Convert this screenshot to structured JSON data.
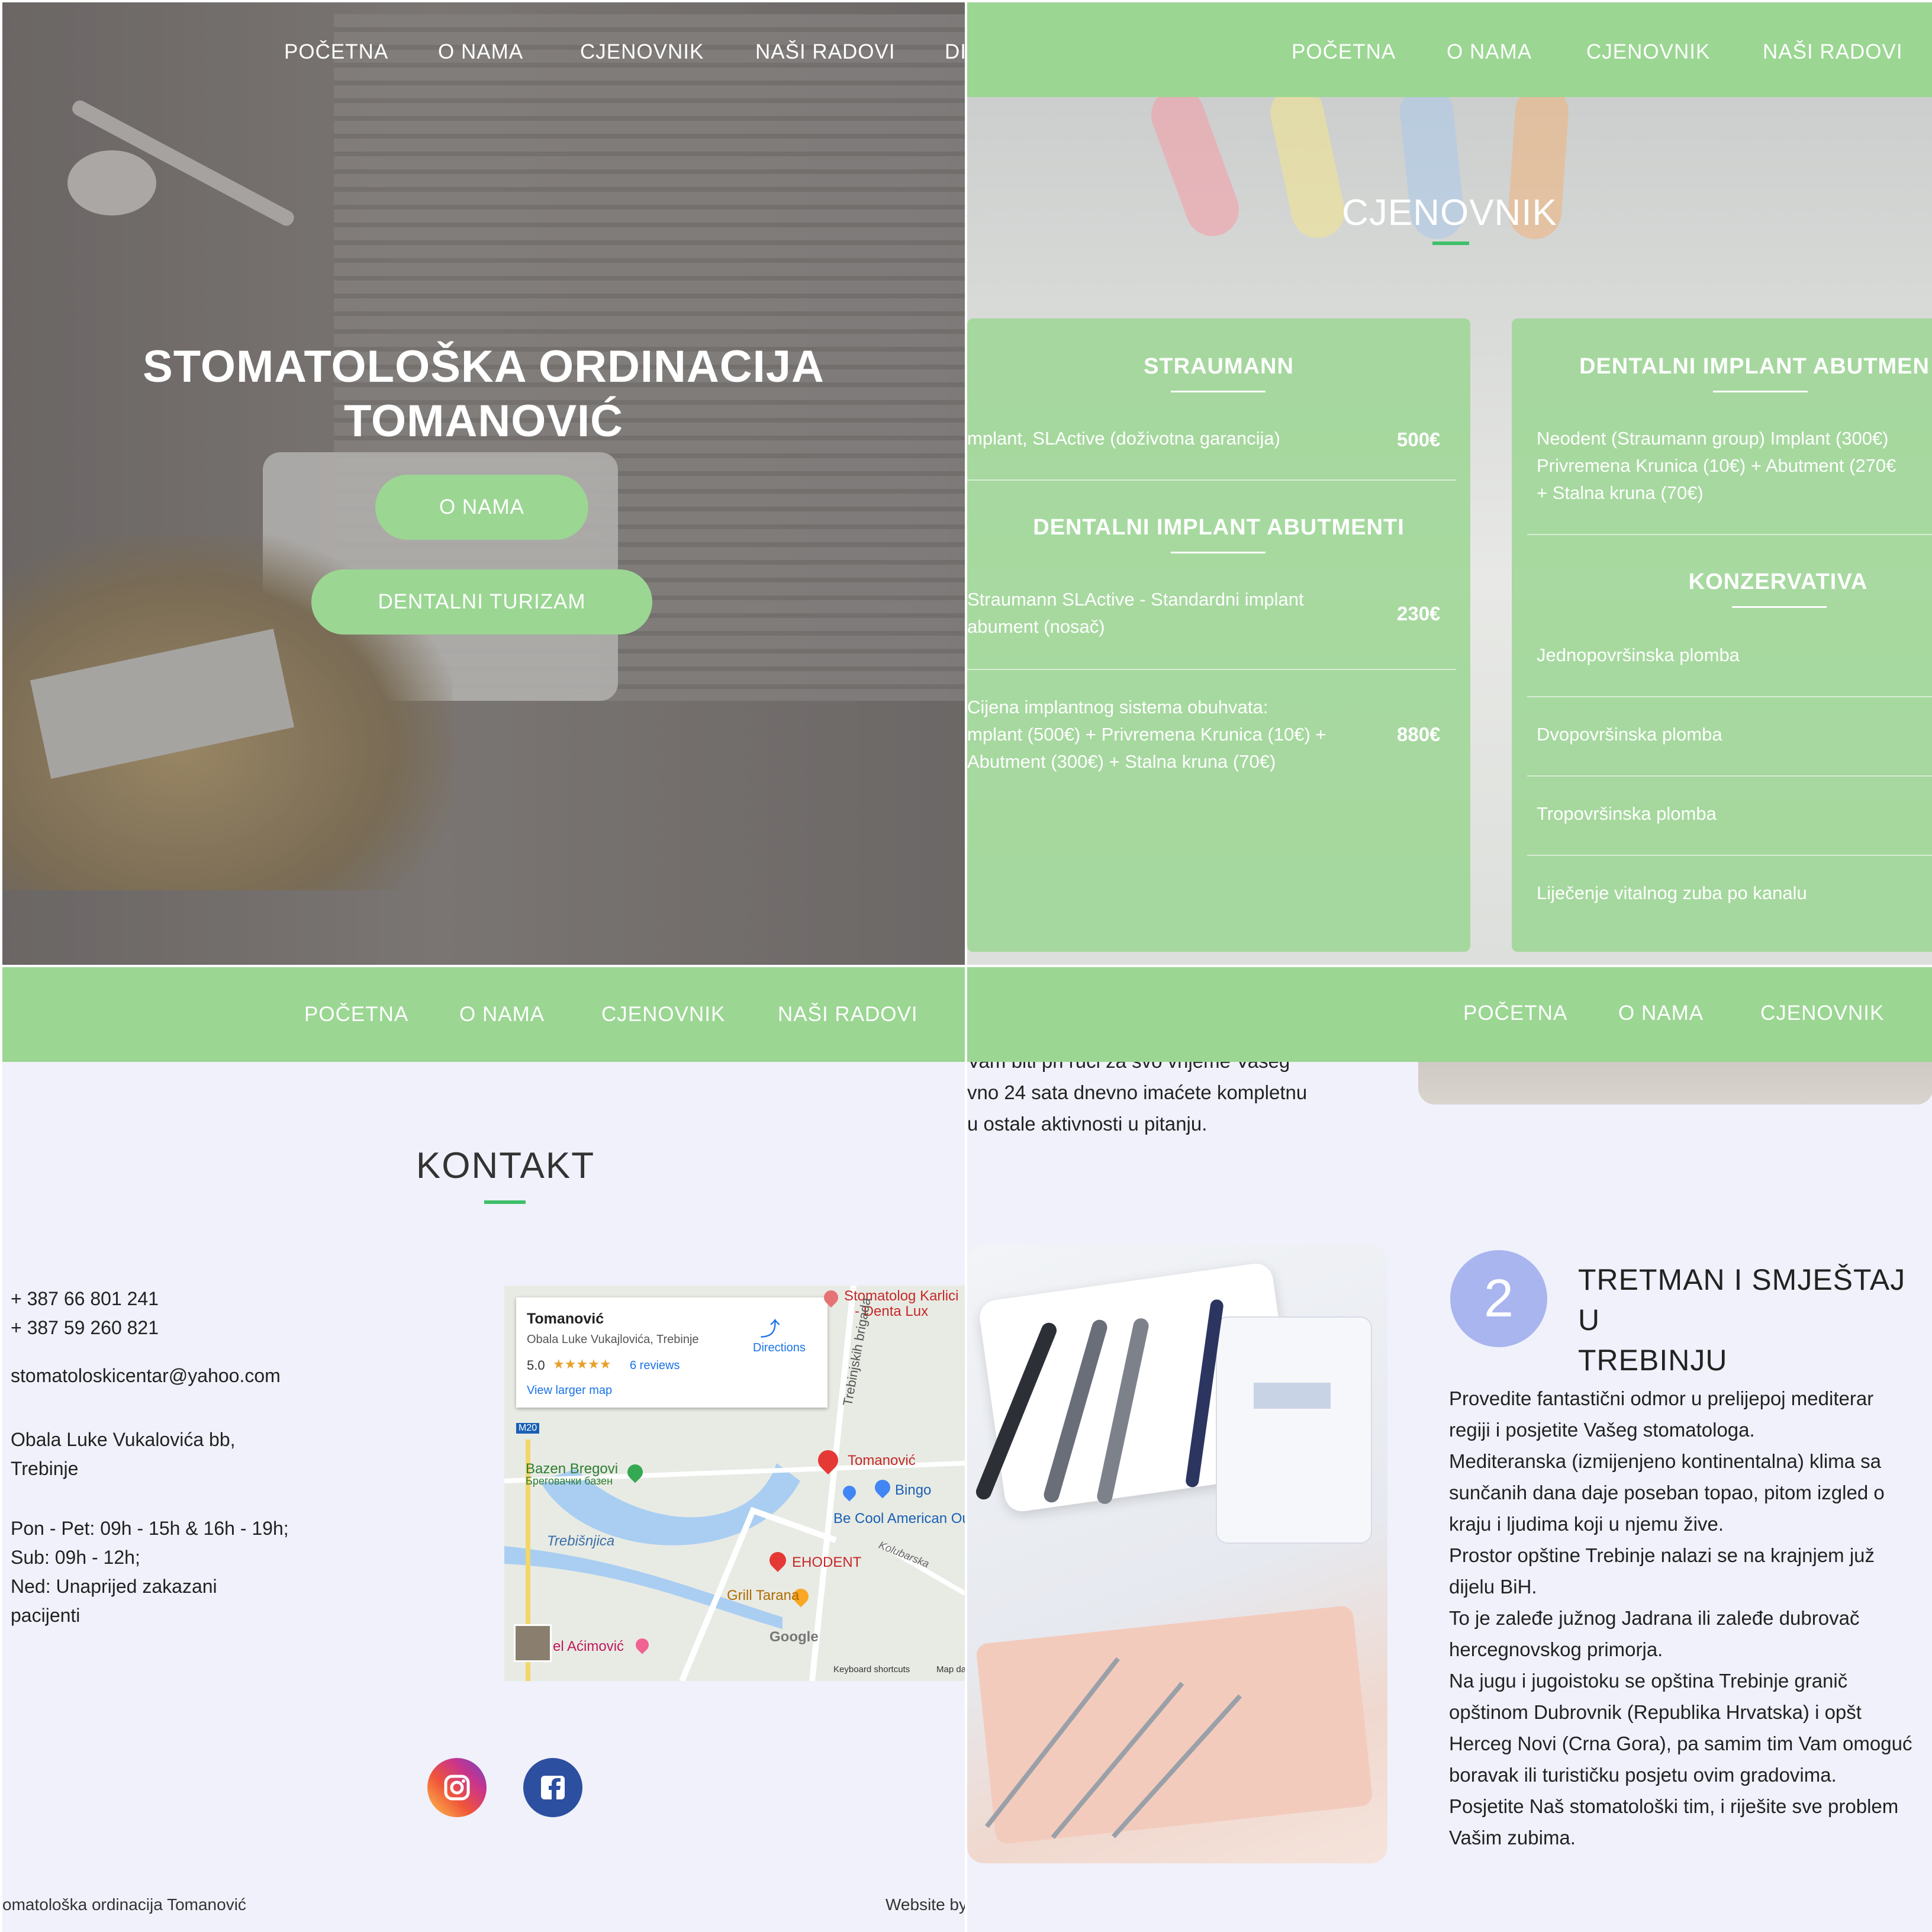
{
  "nav": {
    "items": [
      "POČETNA",
      "O NAMA",
      "CJENOVNIK",
      "NAŠI RADOVI",
      "DI"
    ]
  },
  "hero": {
    "title_line1": "STOMATOLOŠKA ORDINACIJA",
    "title_line2": "TOMANOVIĆ",
    "btn_about": "O NAMA",
    "btn_tourism": "DENTALNI TURIZAM"
  },
  "pricing": {
    "title": "CJENOVNIK",
    "left_card": {
      "section1_title": "STRAUMANN",
      "row1_text": "mplant, SLActive (doživotna garancija)",
      "row1_price": "500€",
      "section2_title": "DENTALNI IMPLANT ABUTMENTI",
      "row2_line1": "Straumann SLActive - Standardni implant",
      "row2_line2": "abument (nosač)",
      "row2_price": "230€",
      "row3_line1": "Cijena implantnog sistema obuhvata:",
      "row3_line2": "mplant (500€) + Privremena Krunica (10€) +",
      "row3_line3": "Abutment (300€) + Stalna kruna (70€)",
      "row3_price": "880€"
    },
    "right_card": {
      "section1_title": "DENTALNI IMPLANT ABUTMEN",
      "row1_line1": "Neodent (Straumann group) Implant (300€)",
      "row1_line2": "Privremena Krunica (10€) + Abutment (270€",
      "row1_line3": "+ Stalna kruna (70€)",
      "section2_title": "KONZERVATIVA",
      "items": [
        "Jednopovršinska plomba",
        "Dvopovršinska plomba",
        "Tropovršinska plomba",
        "Liječenje vitalnog zuba po kanalu"
      ]
    }
  },
  "contact": {
    "title": "KONTAKT",
    "phone1": "+ 387 66 801 241",
    "phone2": "+ 387 59 260 821",
    "email": "stomatoloskicentar@yahoo.com",
    "address_line1": "Obala Luke Vukalovića bb,",
    "address_line2": "Trebinje",
    "hours_line1": "Pon - Pet: 09h - 15h & 16h - 19h;",
    "hours_line2": "Sub: 09h - 12h;",
    "hours_line3": "Ned: Unaprijed zakazani",
    "hours_line4": "pacijenti",
    "map": {
      "place_name": "Tomanović",
      "place_address": "Obala Luke Vukajlovića, Trebinje",
      "rating": "5.0",
      "stars": "★★★★★",
      "reviews": "6 reviews",
      "larger_map": "View larger map",
      "directions": "Directions",
      "labels": {
        "stomatolog1": "Stomatolog Karlici",
        "stomatolog2": "- Denta Lux",
        "brigada": "Trebinjskih brigada",
        "m20": "M20",
        "bazen1": "Bazen Bregovi",
        "bazen2": "Бреговачки базен",
        "tomanovic": "Tomanović",
        "bingo": "Bingo",
        "becool": "Be Cool American Ou",
        "trebisnjica": "Trebišnjica",
        "kolubarska": "Kolubarska",
        "ehodent": "EHODENT",
        "grill": "Grill Tarana",
        "acimovic": "el Aćimović",
        "google": "Google",
        "keyboard": "Keyboard shortcuts",
        "mapdata": "Map da"
      }
    },
    "footer_left": "omatološka ordinacija Tomanović",
    "footer_right": "Website by"
  },
  "tourism": {
    "intro_line1": "Vam biti pri ruci za svo vrijeme Vašeg",
    "intro_line2": "vno 24 sata dnevno imaćete kompletnu",
    "intro_line3": "u ostale aktivnosti u pitanju.",
    "step_number": "2",
    "step_title_line1": "TRETMAN I SMJEŠTAJ U",
    "step_title_line2": "TREBINJU",
    "p_lines": [
      "Provedite fantastični odmor u prelijepoj mediterar",
      "regiji i posjetite Vašeg stomatologa.",
      "Mediteranska (izmijenjeno kontinentalna) klima sa",
      "sunčanih dana daje poseban topao, pitom izgled o",
      "kraju i ljudima koji u njemu žive.",
      "Prostor opštine Trebinje nalazi se na krajnjem juž",
      "dijelu BiH.",
      "To je zaleđe južnog Jadrana ili zaleđe dubrovač",
      "hercegnovskog primorja.",
      "Na jugu i jugoistoku se opština Trebinje granič",
      "opštinom Dubrovnik (Republika Hrvatska) i opšt",
      "Herceg Novi (Crna Gora), pa samim tim Vam omoguć",
      "boravak ili turističku posjetu ovim gradovima.",
      "Posjetite Naš stomatološki tim, i riješite sve problem",
      "Vašim zubima."
    ]
  },
  "colors": {
    "nav_green": "#9bd693",
    "accent_line": "#3fbf6a",
    "step_circle": "#a9b5ef",
    "page_bg": "#f0f1fb"
  }
}
